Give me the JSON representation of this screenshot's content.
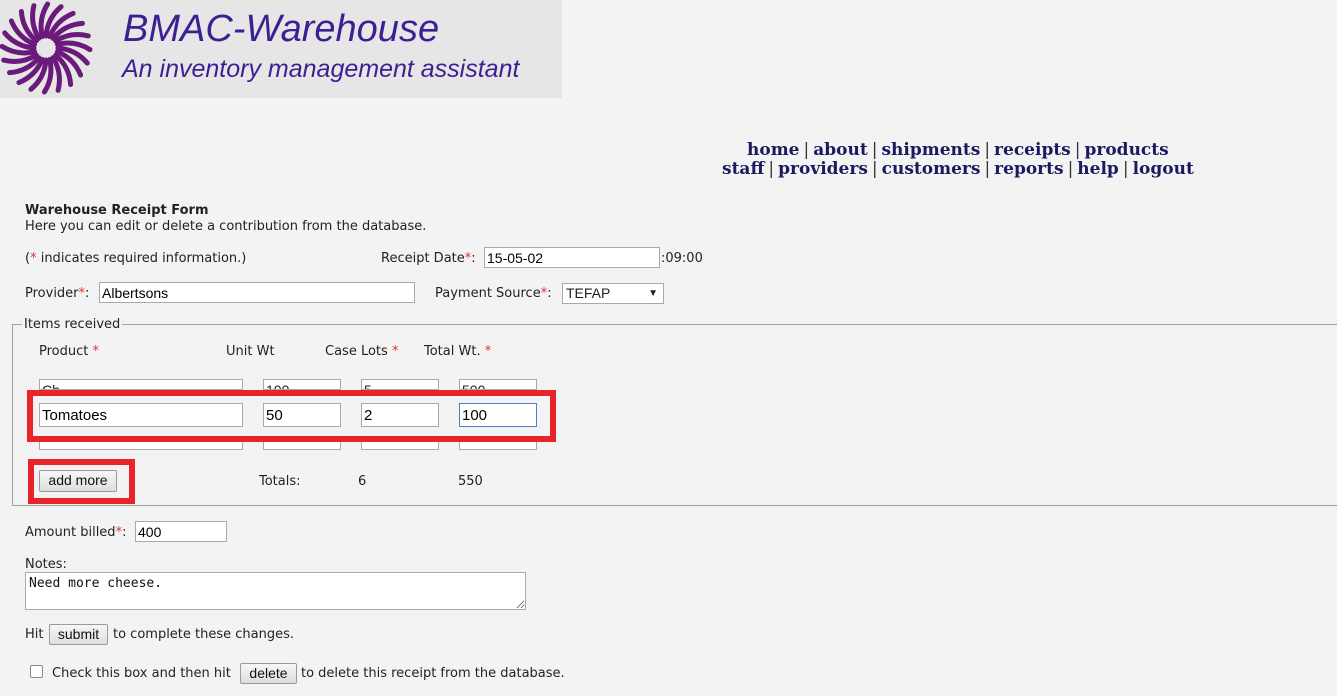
{
  "header": {
    "title": "BMAC-Warehouse",
    "subtitle": "An inventory management assistant"
  },
  "nav": {
    "row1": [
      "home",
      "about",
      "shipments",
      "receipts",
      "products"
    ],
    "row2": [
      "staff",
      "providers",
      "customers",
      "reports",
      "help",
      "logout"
    ]
  },
  "form": {
    "title": "Warehouse Receipt Form",
    "description": "Here you can edit or delete a contribution from the database.",
    "required_note_open": "(",
    "required_star": "*",
    "required_note_text": " indicates required information.)",
    "receipt_date_label": "Receipt Date",
    "receipt_date_value": "15-05-02",
    "receipt_time": ":09:00",
    "provider_label": "Provider",
    "provider_value": "Albertsons",
    "payment_source_label": "Payment Source",
    "payment_source_value": "TEFAP",
    "colon": ":"
  },
  "items": {
    "legend": "Items received",
    "columns": {
      "product": "Product",
      "unit_wt": "Unit Wt",
      "case_lots": "Case Lots",
      "total_wt": "Total Wt."
    },
    "row_partial": {
      "product": "Ch",
      "unit_wt": "100",
      "case_lots": "5",
      "total_wt": "500"
    },
    "row_active": {
      "product": "Tomatoes",
      "unit_wt": "50",
      "case_lots": "2",
      "total_wt": "100"
    },
    "add_more_label": "add more",
    "totals_label": "Totals:",
    "totals_case_lots": "6",
    "totals_weight": "550"
  },
  "billing": {
    "amount_label": "Amount billed",
    "amount_value": "400",
    "notes_label": "Notes:",
    "notes_value": "Need more cheese."
  },
  "actions": {
    "hit_label": "Hit",
    "submit_label": "submit",
    "submit_suffix": "to complete these changes.",
    "delete_prefix": "Check this box and then hit",
    "delete_label": "delete",
    "delete_suffix": "to delete this receipt from the database."
  },
  "colors": {
    "brand": "#3d1f93",
    "highlight": "#e8232a",
    "required": "#e03030",
    "nav": "#1a1a5e"
  }
}
